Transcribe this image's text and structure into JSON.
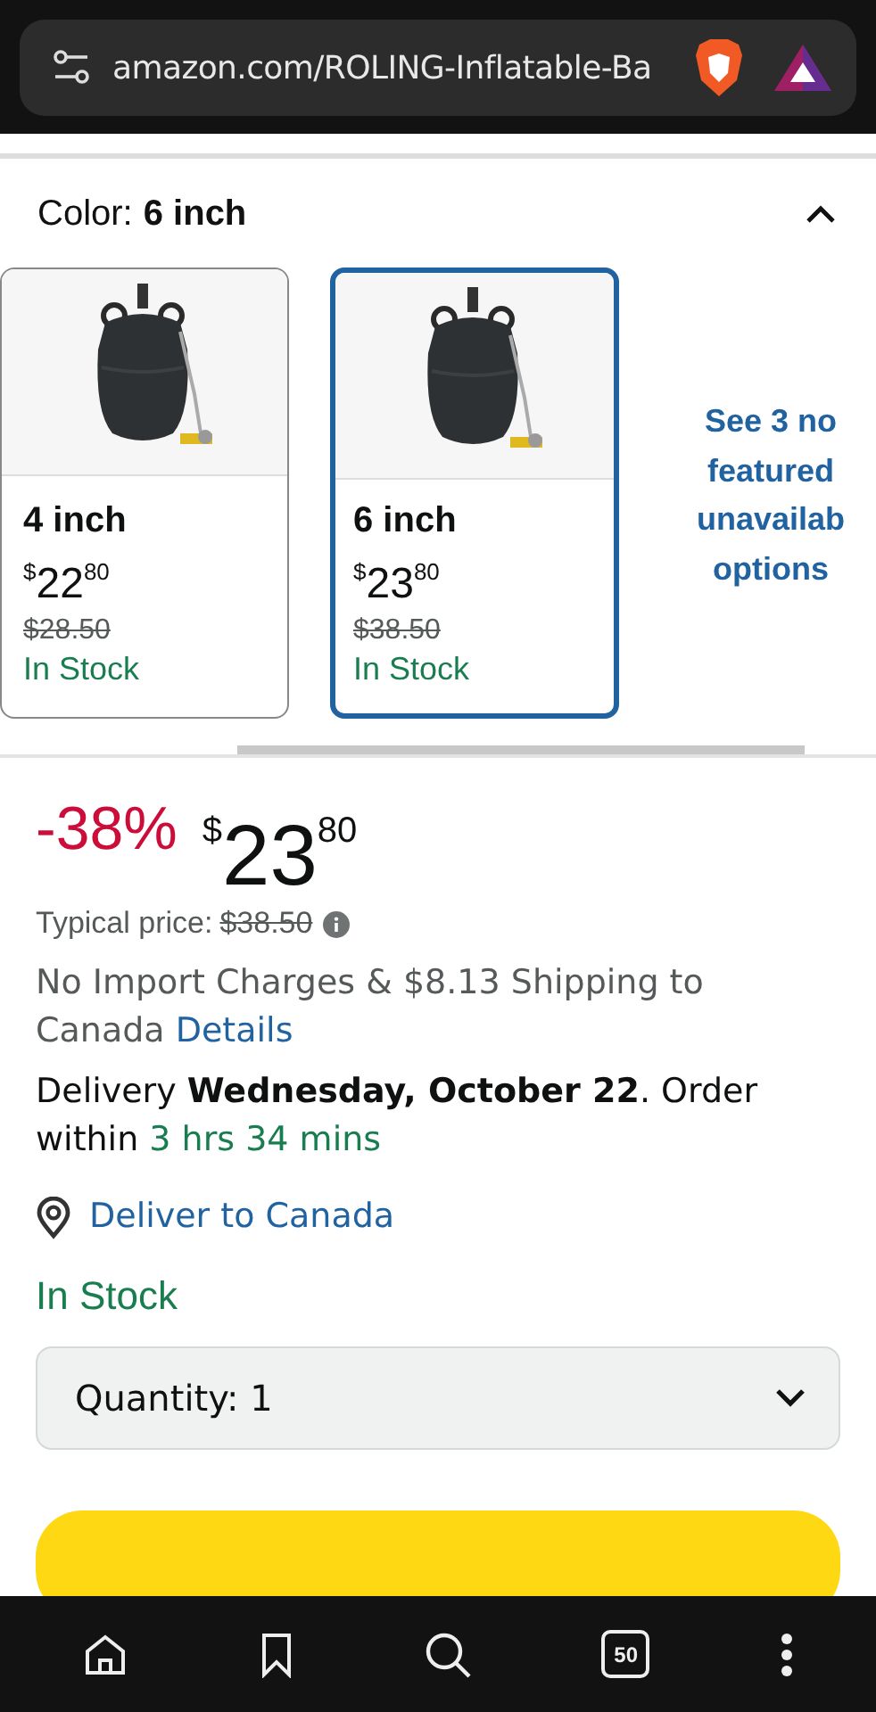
{
  "address_bar": {
    "url": "amazon.com/ROLING-Inflatable-Ba"
  },
  "variation": {
    "label": "Color:",
    "value": "6 inch",
    "expanded": true
  },
  "options": [
    {
      "name": "4 inch",
      "price_symbol": "$",
      "price_whole": "22",
      "price_fraction": "80",
      "list_price": "$28.50",
      "availability": "In Stock",
      "selected": false
    },
    {
      "name": "6 inch",
      "price_symbol": "$",
      "price_whole": "23",
      "price_fraction": "80",
      "list_price": "$38.50",
      "availability": "In Stock",
      "selected": true
    }
  ],
  "more_options": [
    "See 3 no",
    "featured",
    "unavailab",
    "options"
  ],
  "price": {
    "discount": "-38%",
    "symbol": "$",
    "whole": "23",
    "fraction": "80"
  },
  "typical_price": {
    "label": "Typical price:",
    "value": "$38.50"
  },
  "shipping": {
    "text": "No Import Charges & $8.13 Shipping to Canada",
    "link": "Details"
  },
  "delivery": {
    "text": "Delivery **Wednesday, October 22**. Order within",
    "countdown": "3 hrs 34 mins"
  },
  "deliver_to": "Deliver to Canada",
  "availability": "In Stock",
  "quantity": {
    "label": "Quantity:",
    "value": "1"
  },
  "bottom_bar": {
    "tab_count": "50"
  }
}
